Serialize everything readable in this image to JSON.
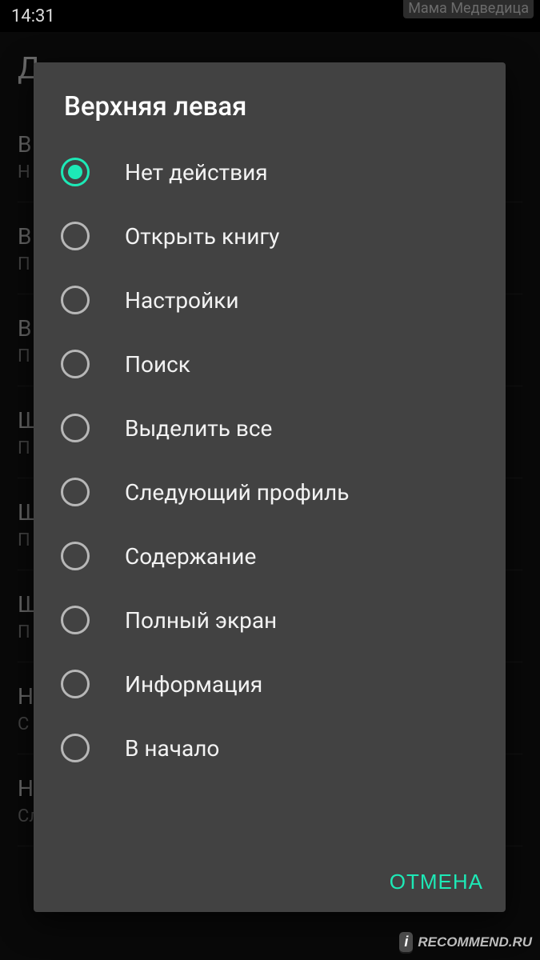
{
  "status": {
    "time": "14:31"
  },
  "page": {
    "title": "Д",
    "rows": [
      {
        "primary": "В",
        "secondary": "Н"
      },
      {
        "primary": "В",
        "secondary": "П"
      },
      {
        "primary": "В",
        "secondary": "П"
      },
      {
        "primary": "Ш",
        "secondary": "П"
      },
      {
        "primary": "Ш",
        "secondary": "П"
      },
      {
        "primary": "Ш",
        "secondary": "П"
      },
      {
        "primary": "Н",
        "secondary": "С"
      },
      {
        "primary": "Нижняя центральная",
        "secondary": "Следующая страница"
      }
    ]
  },
  "dialog": {
    "title": "Верхняя левая",
    "options": [
      {
        "label": "Нет действия",
        "selected": true
      },
      {
        "label": "Открыть книгу",
        "selected": false
      },
      {
        "label": "Настройки",
        "selected": false
      },
      {
        "label": "Поиск",
        "selected": false
      },
      {
        "label": "Выделить все",
        "selected": false
      },
      {
        "label": "Следующий профиль",
        "selected": false
      },
      {
        "label": "Содержание",
        "selected": false
      },
      {
        "label": "Полный экран",
        "selected": false
      },
      {
        "label": "Информация",
        "selected": false
      },
      {
        "label": "В начало",
        "selected": false
      }
    ],
    "cancel": "ОТМЕНА"
  },
  "watermark": {
    "top": "Мама Медведица",
    "bottom_i": "i",
    "bottom_text": "RECOMMEND.RU"
  },
  "colors": {
    "accent": "#1de9b6"
  }
}
